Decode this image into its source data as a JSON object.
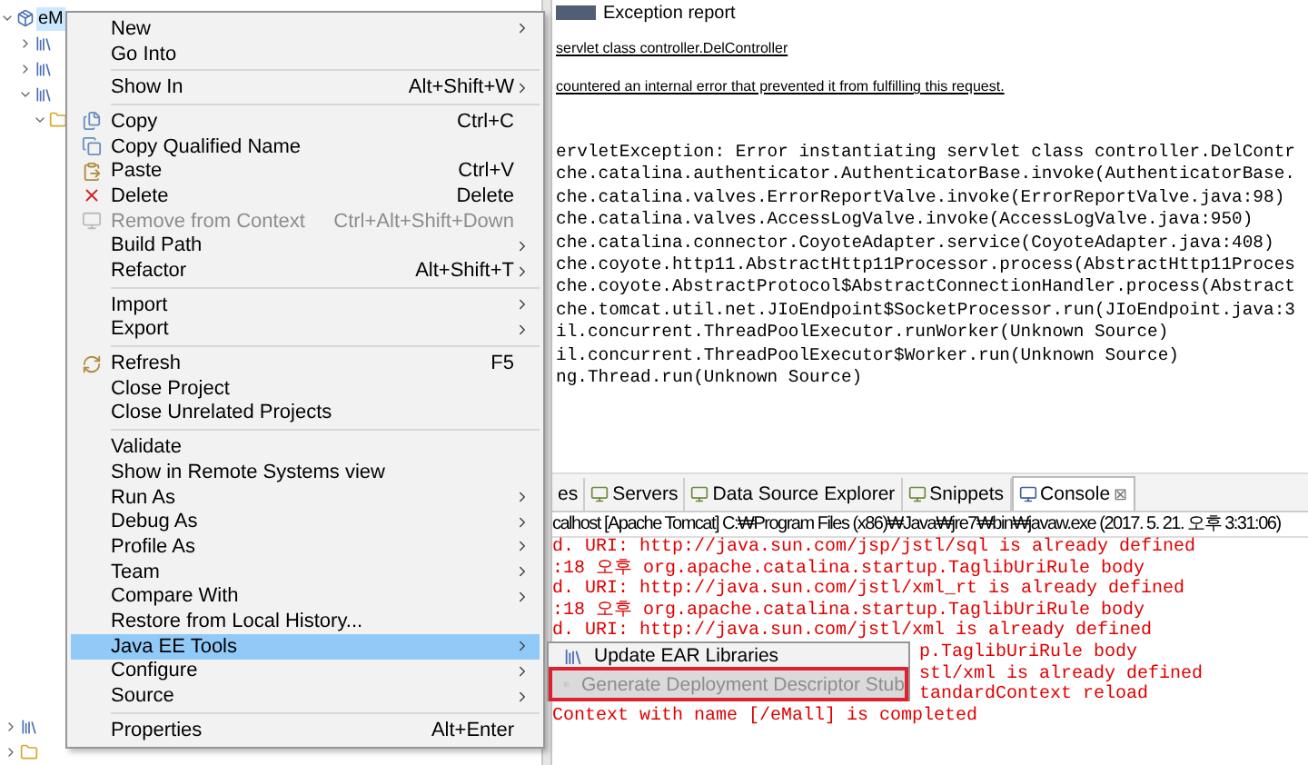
{
  "explorer": {
    "rows": [
      {
        "label": "eM",
        "expanded": true,
        "selected": true
      },
      {
        "expanded": false
      },
      {
        "expanded": false
      },
      {
        "expanded": true
      },
      {
        "expanded": true
      }
    ],
    "bottom_rows": [
      {
        "expanded": false
      },
      {
        "expanded": false
      }
    ]
  },
  "browser": {
    "heading": "Exception report",
    "lines": [
      "servlet class controller.DelController",
      "countered an internal error that prevented it from fulfilling this request."
    ],
    "stack_trace": [
      "ervletException: Error instantiating servlet class controller.DelContr",
      "che.catalina.authenticator.AuthenticatorBase.invoke(AuthenticatorBase.",
      "che.catalina.valves.ErrorReportValve.invoke(ErrorReportValve.java:98)",
      "che.catalina.valves.AccessLogValve.invoke(AccessLogValve.java:950)",
      "che.catalina.connector.CoyoteAdapter.service(CoyoteAdapter.java:408)",
      "che.coyote.http11.AbstractHttp11Processor.process(AbstractHttp11Proces",
      "che.coyote.AbstractProtocol$AbstractConnectionHandler.process(Abstract",
      "che.tomcat.util.net.JIoEndpoint$SocketProcessor.run(JIoEndpoint.java:3",
      "il.concurrent.ThreadPoolExecutor.runWorker(Unknown Source)",
      "il.concurrent.ThreadPoolExecutor$Worker.run(Unknown Source)",
      "ng.Thread.run(Unknown Source)"
    ]
  },
  "view_tabs": [
    {
      "label": "es",
      "selected": false
    },
    {
      "label": "Servers",
      "selected": false
    },
    {
      "label": "Data Source Explorer",
      "selected": false
    },
    {
      "label": "Snippets",
      "selected": false
    },
    {
      "label": "Console",
      "selected": true,
      "close": "⊠"
    }
  ],
  "console": {
    "title": "calhost [Apache Tomcat] C:₩Program Files (x86)₩Java₩jre7₩bin₩javaw.exe (2017. 5. 21. 오후 3:31:06)",
    "lines": [
      {
        "text": "d. URI: http://java.sun.com/jsp/jstl/sql is already defined",
        "kind": "full"
      },
      {
        "text": ":18 오후 org.apache.catalina.startup.TaglibUriRule body",
        "kind": "full"
      },
      {
        "text": "d. URI: http://java.sun.com/jstl/xml_rt is already defined",
        "kind": "full"
      },
      {
        "text": ":18 오후 org.apache.catalina.startup.TaglibUriRule body",
        "kind": "full"
      },
      {
        "text": "d. URI: http://java.sun.com/jstl/xml is already defined",
        "kind": "full"
      },
      {
        "text": "p.TaglibUriRule body",
        "kind": "partial"
      },
      {
        "text": "stl/xml is already defined",
        "kind": "partial"
      },
      {
        "text": "tandardContext reload",
        "kind": "partial"
      },
      {
        "text": "Context with name [/eMall] is completed",
        "kind": "full"
      }
    ]
  },
  "context_menu": {
    "items": [
      {
        "kind": "item",
        "label": "New",
        "submenu": true,
        "disabled": false,
        "selected": false
      },
      {
        "kind": "item",
        "label": "Go Into",
        "submenu": false,
        "disabled": false,
        "selected": false
      },
      {
        "kind": "separator"
      },
      {
        "kind": "item",
        "label": "Show In",
        "shortcut": "Alt+Shift+W",
        "submenu": true,
        "disabled": false,
        "selected": false
      },
      {
        "kind": "separator"
      },
      {
        "kind": "item",
        "label": "Copy",
        "shortcut": "Ctrl+C",
        "submenu": false,
        "disabled": false,
        "selected": false
      },
      {
        "kind": "item",
        "label": "Copy Qualified Name",
        "submenu": false,
        "disabled": false,
        "selected": false
      },
      {
        "kind": "item",
        "label": "Paste",
        "shortcut": "Ctrl+V",
        "submenu": false,
        "disabled": false,
        "selected": false
      },
      {
        "kind": "item",
        "label": "Delete",
        "shortcut": "Delete",
        "submenu": false,
        "disabled": false,
        "selected": false
      },
      {
        "kind": "item",
        "label": "Remove from Context",
        "shortcut": "Ctrl+Alt+Shift+Down",
        "submenu": false,
        "disabled": true,
        "selected": false
      },
      {
        "kind": "item",
        "label": "Build Path",
        "submenu": true,
        "disabled": false,
        "selected": false
      },
      {
        "kind": "item",
        "label": "Refactor",
        "shortcut": "Alt+Shift+T",
        "submenu": true,
        "disabled": false,
        "selected": false
      },
      {
        "kind": "separator"
      },
      {
        "kind": "item",
        "label": "Import",
        "submenu": true,
        "disabled": false,
        "selected": false
      },
      {
        "kind": "item",
        "label": "Export",
        "submenu": true,
        "disabled": false,
        "selected": false
      },
      {
        "kind": "separator"
      },
      {
        "kind": "item",
        "label": "Refresh",
        "shortcut": "F5",
        "submenu": false,
        "disabled": false,
        "selected": false
      },
      {
        "kind": "item",
        "label": "Close Project",
        "submenu": false,
        "disabled": false,
        "selected": false
      },
      {
        "kind": "item",
        "label": "Close Unrelated Projects",
        "submenu": false,
        "disabled": false,
        "selected": false
      },
      {
        "kind": "separator"
      },
      {
        "kind": "item",
        "label": "Validate",
        "submenu": false,
        "disabled": false,
        "selected": false
      },
      {
        "kind": "item",
        "label": "Show in Remote Systems view",
        "submenu": false,
        "disabled": false,
        "selected": false
      },
      {
        "kind": "item",
        "label": "Run As",
        "submenu": true,
        "disabled": false,
        "selected": false
      },
      {
        "kind": "item",
        "label": "Debug As",
        "submenu": true,
        "disabled": false,
        "selected": false
      },
      {
        "kind": "item",
        "label": "Profile As",
        "submenu": true,
        "disabled": false,
        "selected": false
      },
      {
        "kind": "item",
        "label": "Team",
        "submenu": true,
        "disabled": false,
        "selected": false
      },
      {
        "kind": "item",
        "label": "Compare With",
        "submenu": true,
        "disabled": false,
        "selected": false
      },
      {
        "kind": "item",
        "label": "Restore from Local History...",
        "submenu": false,
        "disabled": false,
        "selected": false
      },
      {
        "kind": "item",
        "label": "Java EE Tools",
        "submenu": true,
        "disabled": false,
        "selected": true
      },
      {
        "kind": "item",
        "label": "Configure",
        "submenu": true,
        "disabled": false,
        "selected": false
      },
      {
        "kind": "item",
        "label": "Source",
        "submenu": true,
        "disabled": false,
        "selected": false
      },
      {
        "kind": "separator"
      },
      {
        "kind": "item",
        "label": "Properties",
        "shortcut": "Alt+Enter",
        "submenu": false,
        "disabled": false,
        "selected": false
      }
    ]
  },
  "submenu": {
    "items": [
      {
        "label": "Update EAR Libraries",
        "disabled": false,
        "selected": false
      },
      {
        "label": "Generate Deployment Descriptor Stub",
        "disabled": true,
        "selected": true
      }
    ]
  }
}
